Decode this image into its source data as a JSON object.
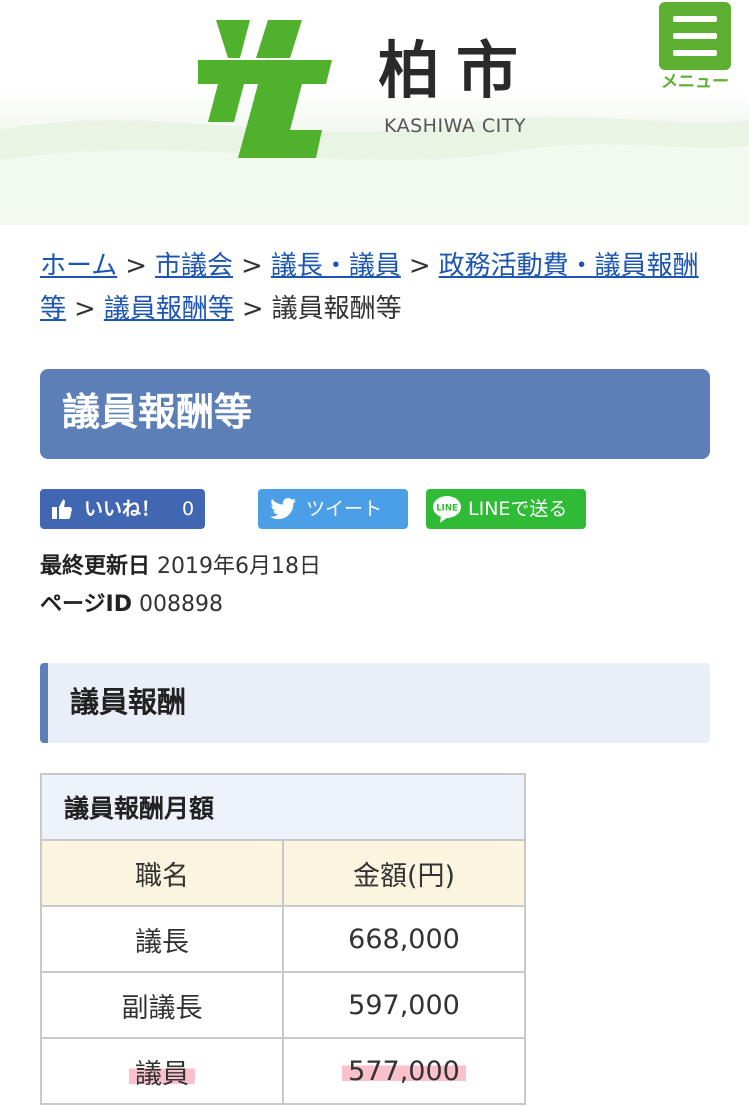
{
  "header": {
    "logo_kanji": "柏市",
    "logo_sub": "KASHIWA CITY",
    "menu_label": "メニュー"
  },
  "breadcrumb": {
    "items": [
      "ホーム",
      "市議会",
      "議長・議員",
      "政務活動費・議員報酬等",
      "議員報酬等"
    ],
    "separator": ">",
    "current": "議員報酬等"
  },
  "page": {
    "title": "議員報酬等"
  },
  "sns": {
    "like_label": "いいね！",
    "like_count": "0",
    "tweet_label": "ツイート",
    "line_label": "LINEで送る"
  },
  "meta": {
    "updated_label": "最終更新日",
    "updated_value": "2019年6月18日",
    "page_id_label": "ページID",
    "page_id_value": "008898"
  },
  "section": {
    "heading": "議員報酬"
  },
  "table": {
    "caption": "議員報酬月額",
    "headers": [
      "職名",
      "金額(円)"
    ],
    "rows": [
      {
        "title": "議長",
        "amount": "668,000"
      },
      {
        "title": "副議長",
        "amount": "597,000"
      },
      {
        "title": "議員",
        "amount": "577,000"
      }
    ],
    "highlight_row": 2
  },
  "colors": {
    "brand_green": "#5bb12f",
    "title_blue": "#5b7fb6",
    "link_blue": "#1d55b3",
    "highlight_pink": "#f58ca0"
  }
}
